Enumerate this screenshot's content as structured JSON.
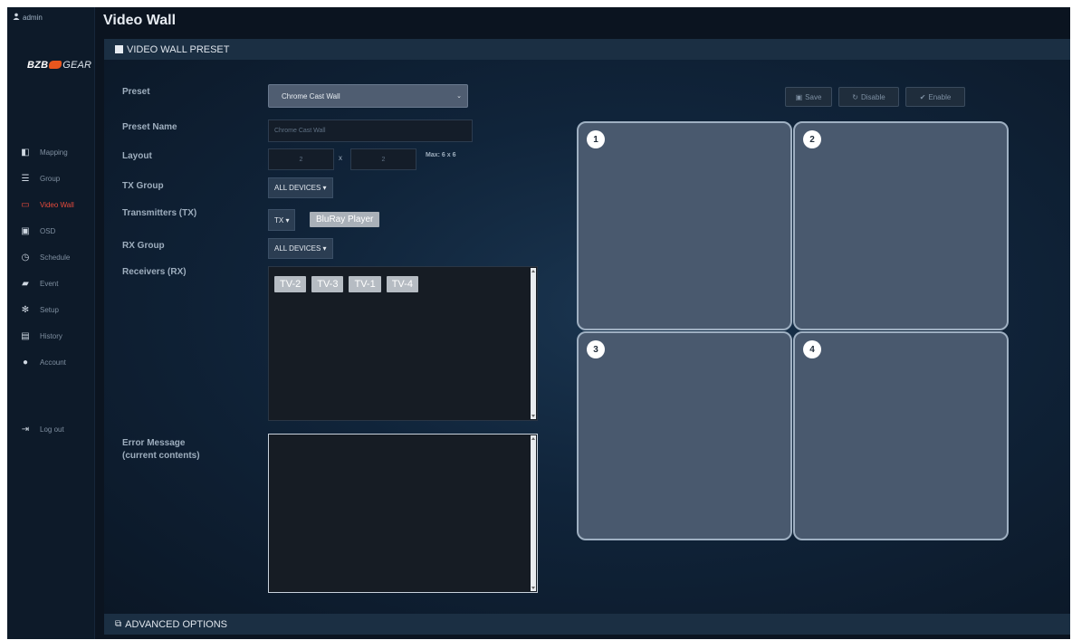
{
  "sidebar": {
    "user": "admin",
    "logo": {
      "part1": "BZB",
      "part2": "GEAR"
    },
    "items": [
      {
        "label": "Mapping",
        "icon": "mapping-icon",
        "active": false
      },
      {
        "label": "Group",
        "icon": "list-icon",
        "active": false
      },
      {
        "label": "Video Wall",
        "icon": "monitor-icon",
        "active": true
      },
      {
        "label": "OSD",
        "icon": "osd-icon",
        "active": false
      },
      {
        "label": "Schedule",
        "icon": "clock-icon",
        "active": false
      },
      {
        "label": "Event",
        "icon": "briefcase-icon",
        "active": false
      },
      {
        "label": "Setup",
        "icon": "gear-icon",
        "active": false
      },
      {
        "label": "History",
        "icon": "history-icon",
        "active": false
      },
      {
        "label": "Account",
        "icon": "user-icon",
        "active": false
      }
    ],
    "logout": "Log out",
    "active_color": "#e84b3c"
  },
  "page": {
    "title": "Video Wall"
  },
  "section": {
    "preset_title": "VIDEO WALL PRESET",
    "advanced_title": "ADVANCED OPTIONS"
  },
  "form": {
    "preset_label": "Preset",
    "preset_value": "Chrome Cast Wall",
    "preset_name_label": "Preset Name",
    "preset_name_value": "Chrome Cast Wall",
    "layout_label": "Layout",
    "layout_cols": "2",
    "layout_x": "x",
    "layout_rows": "2",
    "layout_max": "Max: 6 x 6",
    "tx_group_label": "TX Group",
    "tx_group_value": "ALL DEVICES ▾",
    "tx_label": "Transmitters (TX)",
    "tx_dropdown": "TX ▾",
    "tx_selected": "BluRay Player",
    "rx_group_label": "RX Group",
    "rx_group_value": "ALL DEVICES ▾",
    "rx_label": "Receivers (RX)",
    "rx_tags": [
      "TV-2",
      "TV-3",
      "TV-1",
      "TV-4"
    ],
    "error_label_1": "Error Message",
    "error_label_2": "(current contents)"
  },
  "toolbar": {
    "save": "Save",
    "disable": "Disable",
    "enable": "Enable"
  },
  "wall": {
    "tiles": [
      "1",
      "2",
      "3",
      "4"
    ]
  }
}
